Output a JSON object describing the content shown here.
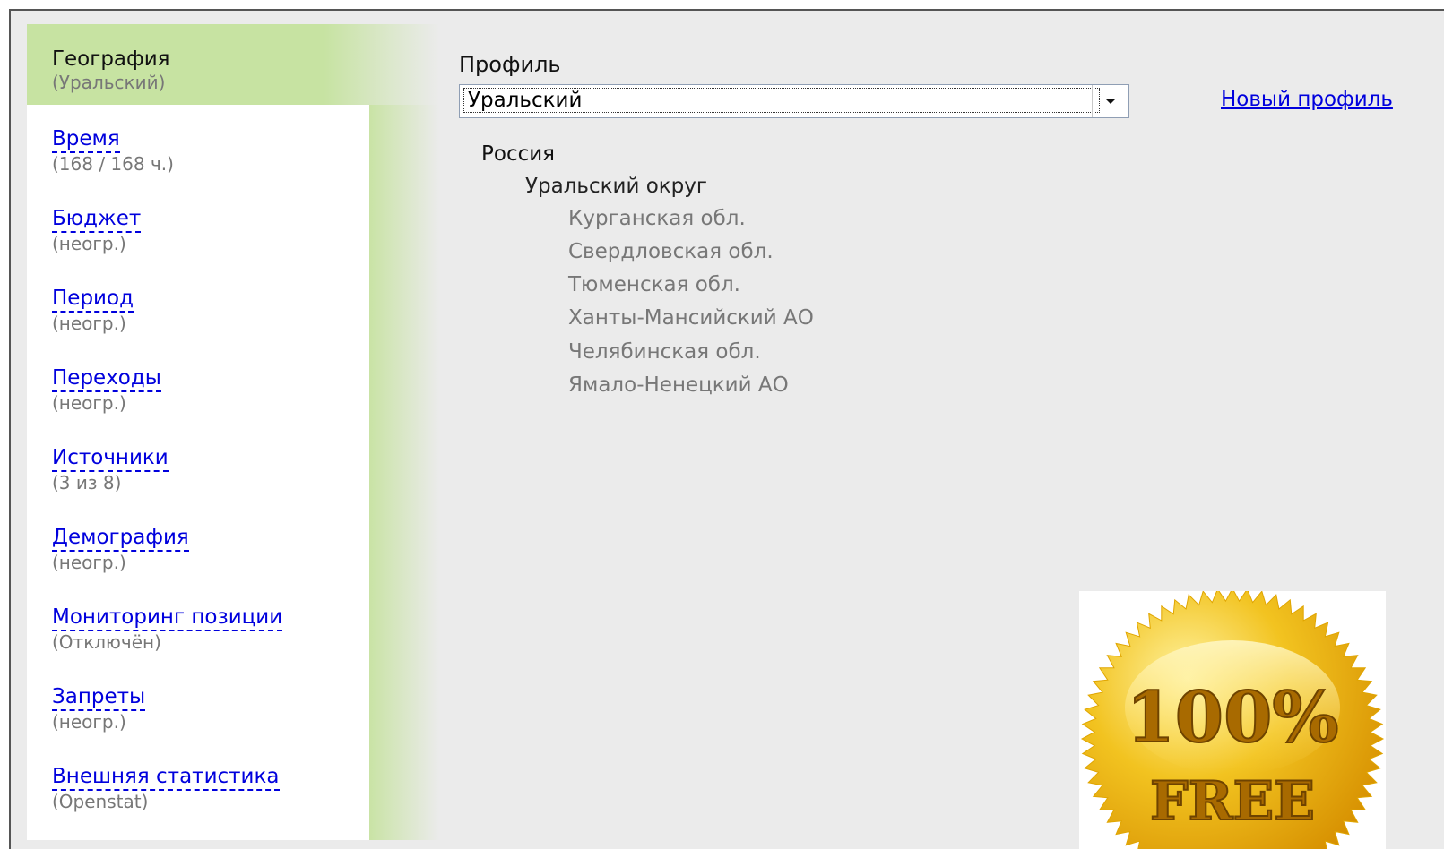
{
  "sidebar": {
    "items": [
      {
        "label": "География",
        "sub": "(Уральский)"
      },
      {
        "label": "Время",
        "sub": "(168 / 168 ч.)"
      },
      {
        "label": "Бюджет",
        "sub": "(неогр.)"
      },
      {
        "label": "Период",
        "sub": "(неогр.)"
      },
      {
        "label": "Переходы",
        "sub": "(неогр.)"
      },
      {
        "label": "Источники",
        "sub": "(3 из 8)"
      },
      {
        "label": "Демография",
        "sub": "(неогр.)"
      },
      {
        "label": "Мониторинг позиции",
        "sub": "(Отключён)"
      },
      {
        "label": "Запреты",
        "sub": "(неогр.)"
      },
      {
        "label": "Внешняя статистика",
        "sub": "(Openstat)"
      }
    ]
  },
  "profile": {
    "label": "Профиль",
    "selected": "Уральский",
    "new_link": "Новый профиль"
  },
  "tree": {
    "country": "Россия",
    "district": "Уральский округ",
    "regions": [
      "Курганская обл.",
      "Свердловская обл.",
      "Тюменская обл.",
      "Ханты-Мансийский АО",
      "Челябинская обл.",
      "Ямало-Ненецкий АО"
    ]
  },
  "badge": {
    "line1": "100%",
    "line2": "FREE"
  },
  "colors": {
    "active_bg": "#c7e3a2",
    "link": "#0000dd",
    "page_bg": "#ebebeb"
  }
}
